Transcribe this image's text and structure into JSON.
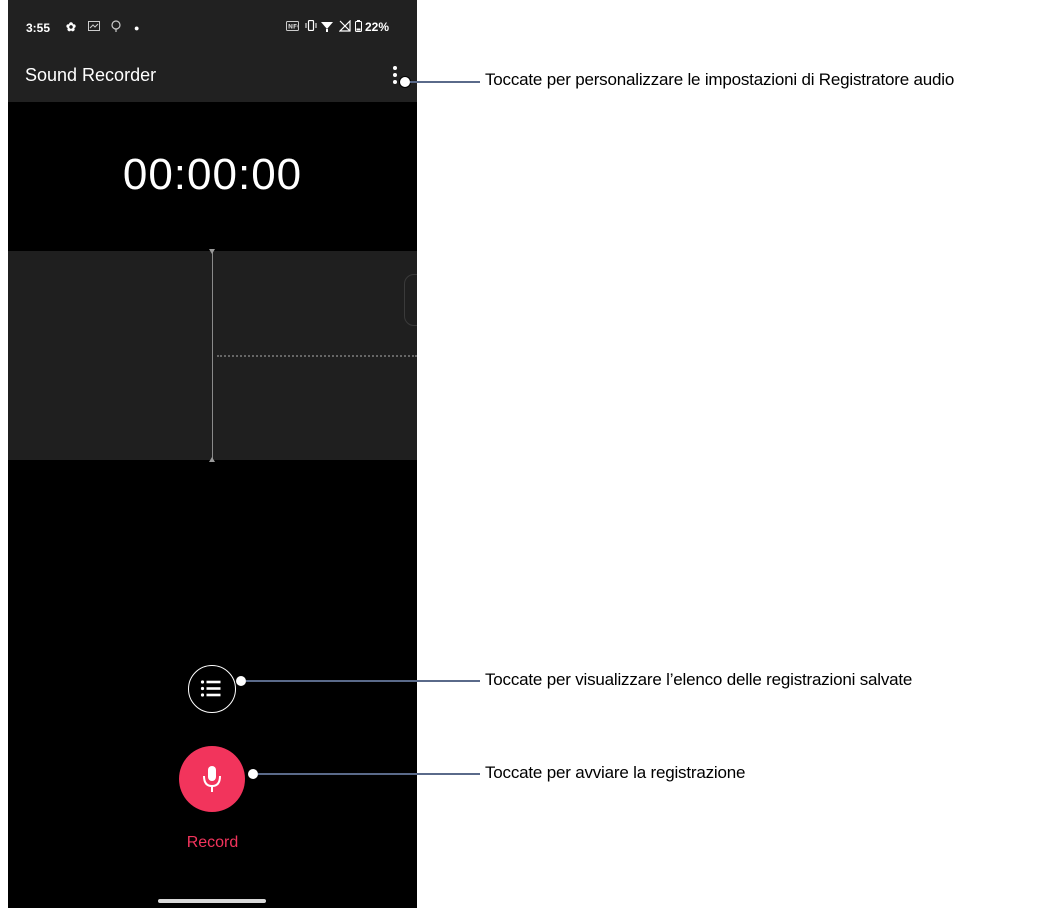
{
  "status_bar": {
    "time": "3:55",
    "left_icons": [
      "settings-icon",
      "photo-icon",
      "bulb-icon",
      "dot-icon"
    ],
    "right_icons": [
      "nfc-icon",
      "vibrate-icon",
      "wifi-icon",
      "no-signal-icon",
      "battery-icon"
    ],
    "battery": "22%"
  },
  "app_bar": {
    "title": "Sound Recorder",
    "menu_icon": "more-vert-icon"
  },
  "timer": "00:00:00",
  "controls": {
    "list_icon": "list-icon",
    "record_icon": "mic-icon",
    "record_label": "Record"
  },
  "colors": {
    "accent": "#f2345c",
    "bar_bg": "#212121",
    "wave_bg": "#1f1f1f"
  },
  "callouts": {
    "settings": "Toccate per personalizzare le impostazioni di Registratore audio",
    "list": "Toccate per visualizzare l’elenco delle registrazioni salvate",
    "record": "Toccate per avviare la registrazione"
  }
}
